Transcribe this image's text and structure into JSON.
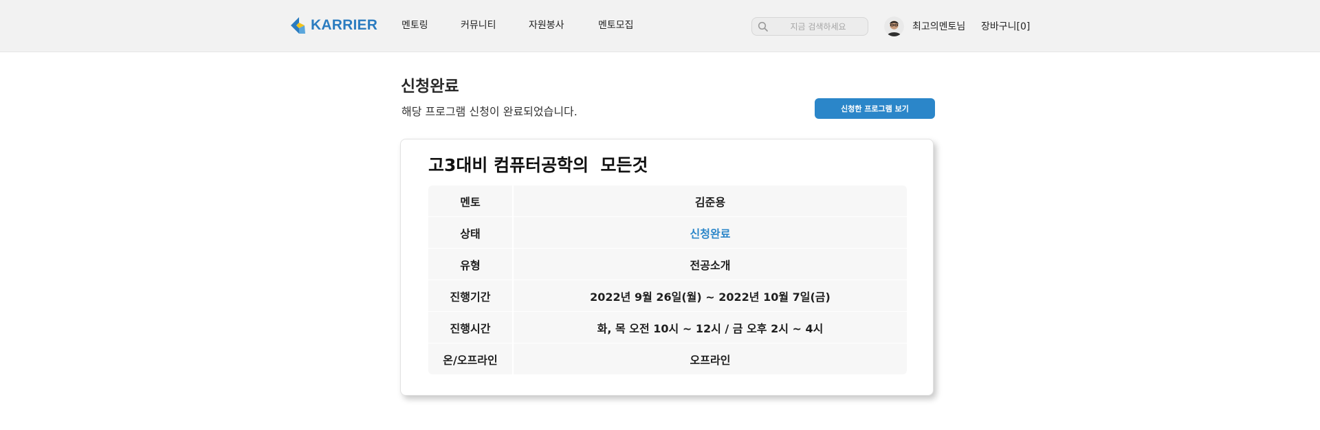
{
  "header": {
    "logo_text": "KARRIER",
    "nav": [
      {
        "label": "멘토링"
      },
      {
        "label": "커뮤니티"
      },
      {
        "label": "자원봉사"
      },
      {
        "label": "멘토모집"
      }
    ],
    "search": {
      "placeholder": "지금 검색하세요",
      "value": "",
      "icon": "search-icon"
    },
    "user_name": "최고의멘토님",
    "cart_label": "장바구니[0]"
  },
  "page": {
    "title": "신청완료",
    "subtitle": "해당 프로그램 신청이 완료되었습니다.",
    "view_button_label": "신청한 프로그램 보기"
  },
  "program": {
    "title": "고3대비 컴퓨터공학의  모든것",
    "rows": [
      {
        "label": "멘토",
        "value": "김준용"
      },
      {
        "label": "상태",
        "value": "신청완료"
      },
      {
        "label": "유형",
        "value": "전공소개"
      },
      {
        "label": "진행기간",
        "value": "2022년 9월 26일(월) ~ 2022년 10월 7일(금)"
      },
      {
        "label": "진행시간",
        "value": "화, 목 오전 10시 ~ 12시 / 금 오후 2시 ~ 4시"
      },
      {
        "label": "온/오프라인",
        "value": "오프라인"
      }
    ]
  },
  "colors": {
    "brand": "#2b7cc0",
    "accent": "#2b86c9",
    "header_bg": "#f2f2f2",
    "cell_bg": "#f7f7f7",
    "logo_yellow": "#f2c31b"
  }
}
